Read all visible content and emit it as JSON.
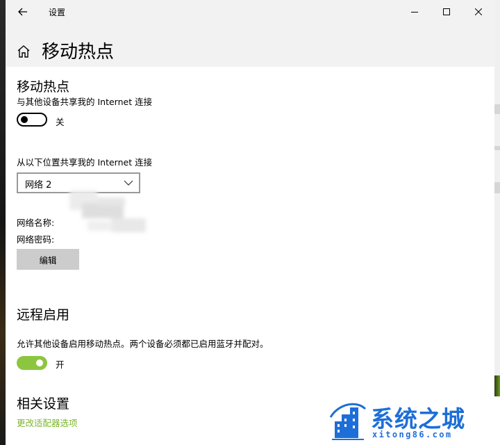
{
  "window": {
    "app_title": "设置"
  },
  "page": {
    "title": "移动热点"
  },
  "hotspot": {
    "heading": "移动热点",
    "share_label": "与其他设备共享我的 Internet 连接",
    "toggle_state": "关",
    "from_label": "从以下位置共享我的 Internet 连接",
    "connection_value": "网络 2",
    "network_name_label": "网络名称:",
    "network_password_label": "网络密码:",
    "edit_button": "编辑"
  },
  "remote": {
    "heading": "远程启用",
    "description": "允许其他设备启用移动热点。两个设备必须都已启用蓝牙并配对。",
    "toggle_state": "开"
  },
  "related": {
    "heading": "相关设置",
    "link": "更改适配器选项"
  },
  "watermark": {
    "title": "系统之城",
    "url": "xitong86.com"
  },
  "colors": {
    "accent": "#8cc63f",
    "link": "#7bb62e",
    "watermark": "#1d6ed8"
  }
}
